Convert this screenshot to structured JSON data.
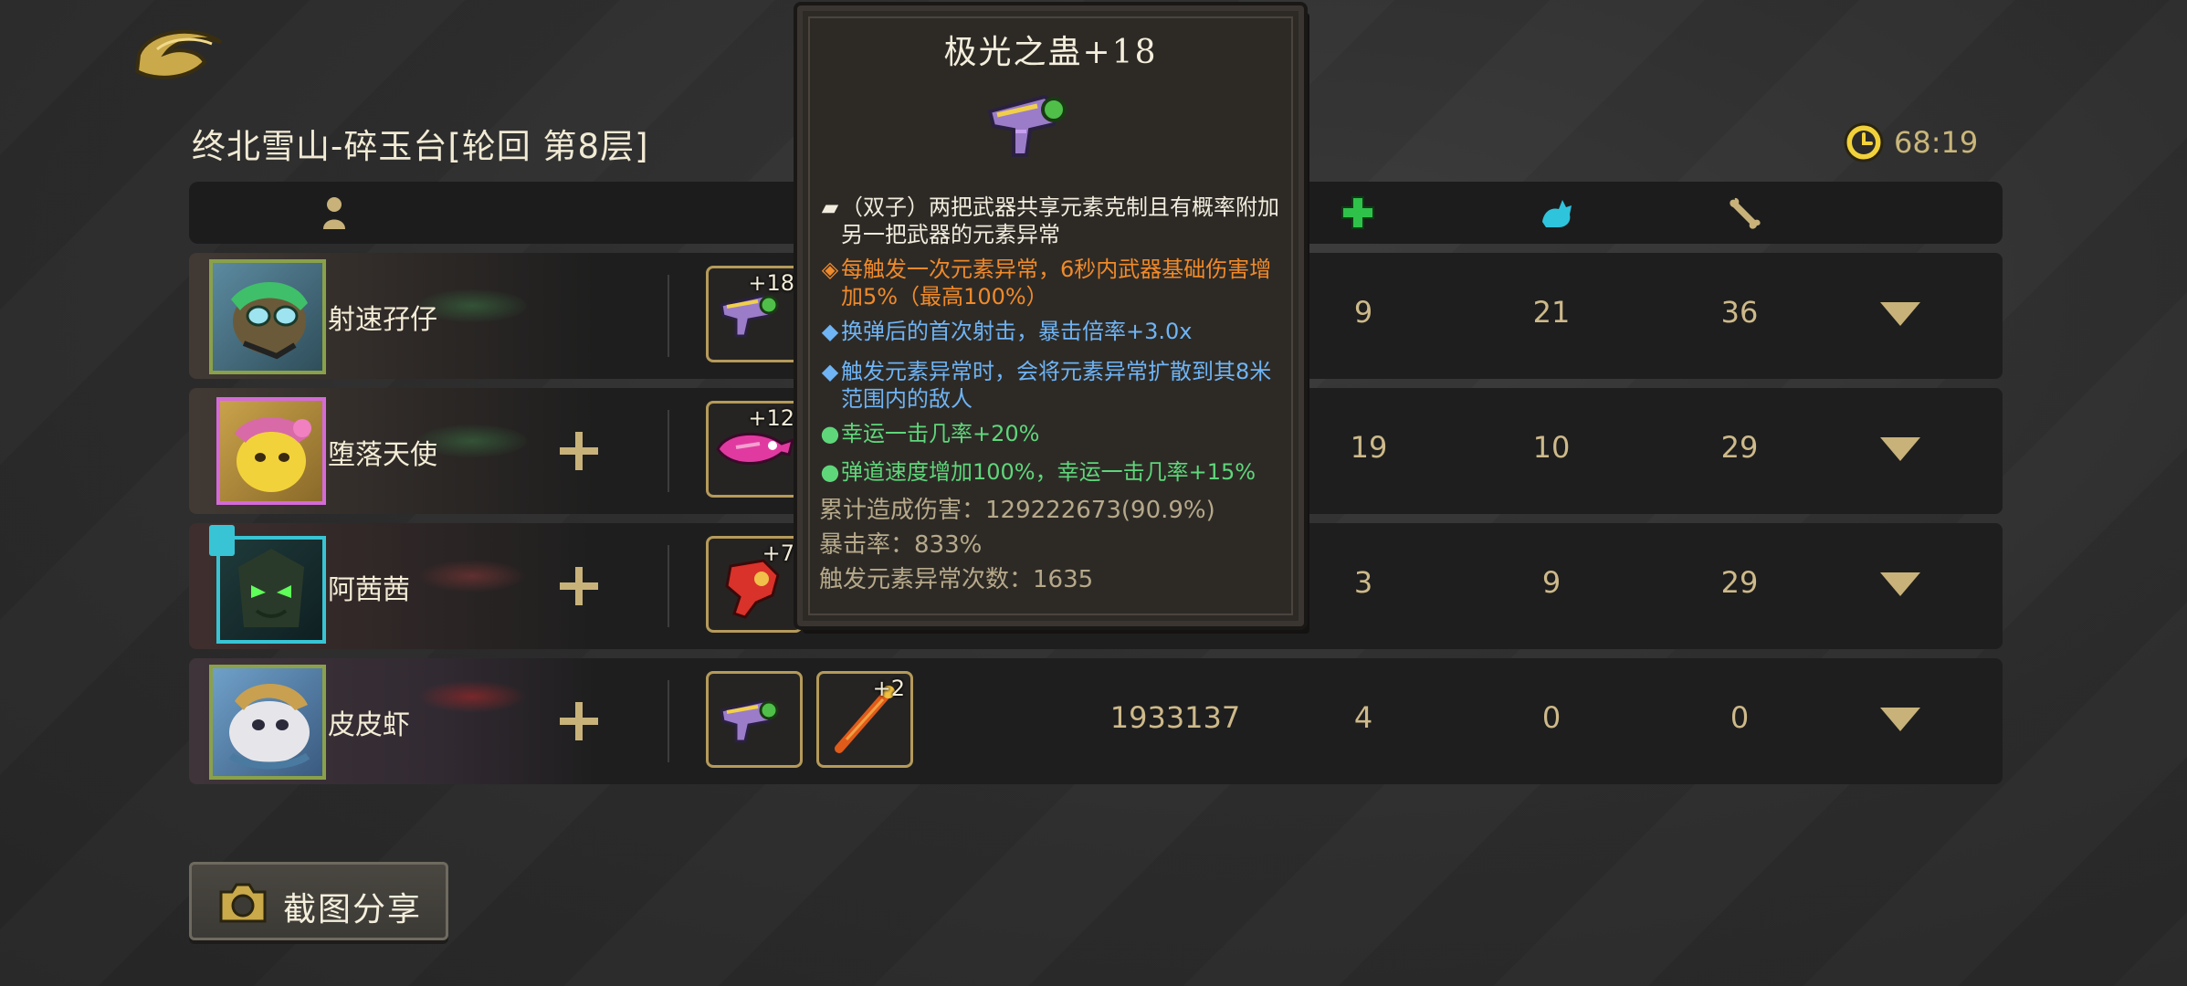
{
  "header": {
    "title": "终北雪山-碎玉台[轮回 第8层]",
    "timer": "68:19"
  },
  "columns": {
    "player_icon": "person-icon",
    "heal_icon": "green-cross-icon",
    "pet_icon": "cyan-cat-icon",
    "bone_icon": "bone-icon"
  },
  "players": [
    {
      "name": "射速孖仔",
      "weapons": [
        {
          "level": "+18"
        }
      ],
      "stats": [
        "9",
        "21",
        "36"
      ],
      "frame_color": "#8aa14a"
    },
    {
      "name": "堕落天使",
      "weapons": [
        {
          "level": "+12"
        }
      ],
      "stats": [
        "19",
        "10",
        "29"
      ],
      "frame_color": "#d46bd8"
    },
    {
      "name": "阿茜茜",
      "weapons": [
        {
          "level": "+7"
        }
      ],
      "stats": [
        "3",
        "9",
        "29"
      ],
      "frame_color": "#38c4d4"
    },
    {
      "name": "皮皮虾",
      "weapons": [
        {
          "level": ""
        },
        {
          "level": "+2"
        }
      ],
      "damage": "1933137",
      "stats": [
        "4",
        "0",
        "0"
      ],
      "frame_color": "#8aa14a"
    }
  ],
  "tooltip": {
    "title": "极光之蛊+18",
    "lines": [
      {
        "bullet": "▰",
        "text": "（双子）两把武器共享元素克制且有概率附加另一把武器的元素异常",
        "color": "white"
      },
      {
        "bullet": "◈",
        "text": "每触发一次元素异常，6秒内武器基础伤害增加5%（最高100%）",
        "color": "orange"
      },
      {
        "bullet": "◆",
        "text": "换弹后的首次射击，暴击倍率+3.0x",
        "color": "blue"
      },
      {
        "bullet": "◆",
        "text": "触发元素异常时，会将元素异常扩散到其8米范围内的敌人",
        "color": "blue"
      },
      {
        "bullet": "●",
        "text": "幸运一击几率+20%",
        "color": "green"
      },
      {
        "bullet": "●",
        "text": "弹道速度增加100%，幸运一击几率+15%",
        "color": "green"
      }
    ],
    "stats": [
      "累计造成伤害：129222673(90.9%)",
      "暴击率：833%",
      "触发元素异常次数：1635"
    ]
  },
  "share": {
    "label": "截图分享"
  }
}
